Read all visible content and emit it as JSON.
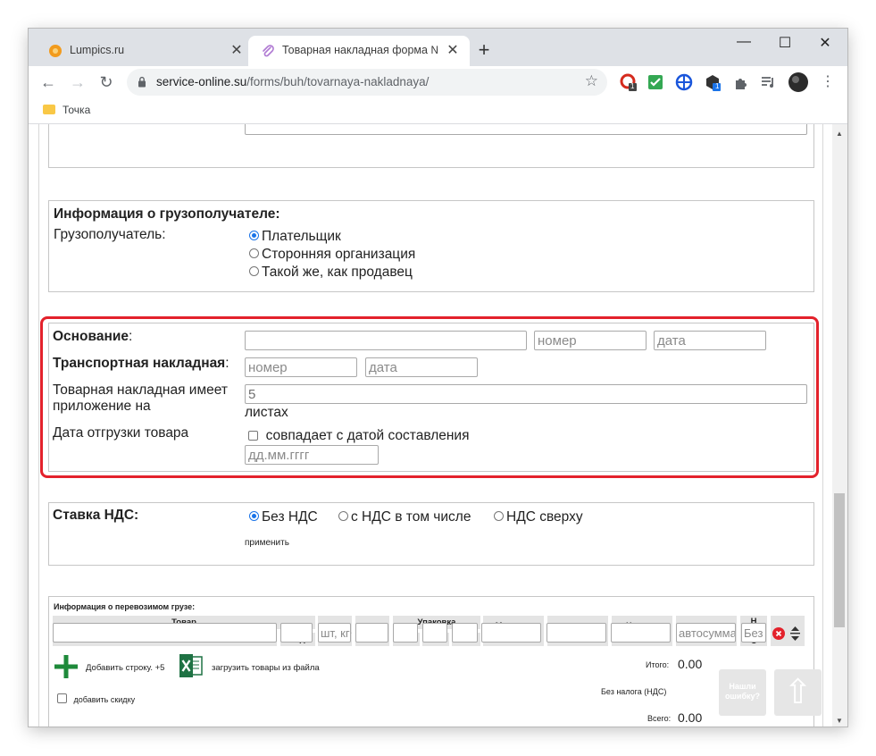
{
  "browser": {
    "tabs": [
      {
        "title": "Lumpics.ru",
        "favicon": "lumpics-orange-circle-icon",
        "active": false
      },
      {
        "title": "Товарная накладная форма №",
        "favicon": "paperclip-icon",
        "active": true
      }
    ],
    "new_tab": "+",
    "window_controls": {
      "minimize": "—",
      "maximize": "☐",
      "close": "✕"
    },
    "url_domain": "service-online.su",
    "url_path": "/forms/buh/tovarnaya-nakladnaya/",
    "bookmarks": [
      "Точка"
    ],
    "extension_badges": [
      "1",
      "1"
    ]
  },
  "form": {
    "consignee_section": {
      "heading": "Информация о грузополучателе:",
      "label": "Грузополучатель:",
      "options": [
        "Плательщик",
        "Сторонняя организация",
        "Такой же, как продавец"
      ],
      "selected": 0
    },
    "basis_section": {
      "basis_label": "Основание",
      "basis_colon": ":",
      "number_placeholder": "номер",
      "date_placeholder": "дата",
      "transport_label": "Транспортная накладная",
      "transport_colon": ":",
      "transport_number_placeholder": "номер",
      "transport_date_placeholder": "дата",
      "attachment_label_line1": "Товарная накладная имеет",
      "attachment_label_line2": "приложение на",
      "attachment_value": "5",
      "sheets_label": "листах",
      "shipment_label": "Дата отгрузки товара",
      "same_date_label": "совпадает с датой составления",
      "date_placeholder_format": "дд.мм.гггг"
    },
    "vat_section": {
      "heading": "Ставка НДС:",
      "options": [
        "Без НДС",
        "с НДС в том числе",
        "НДС сверху"
      ],
      "selected": 0,
      "apply_link": "применить"
    },
    "cargo_section": {
      "heading": "Информация о перевозимом грузе:",
      "headers": {
        "goods": "Товар",
        "name": "наименование",
        "code": "код",
        "unit": "Ед. изм.",
        "okei": "код ОКЕИ",
        "package": "Упаковка",
        "pkg_type": "вид уп.",
        "pkg_qty": "к.в.о.м",
        "pkg_places": "к.мест",
        "mass": "Масса кг единицы",
        "qty": "Кол-во",
        "price": "Цена за единицу",
        "sum": "Сумма",
        "vat": "НДС"
      },
      "row_placeholders": {
        "unit": "шт, кг",
        "sum": "автосумма",
        "vat": "Без"
      },
      "add_row_label": "Добавить строку. +5",
      "load_file_label": "загрузить товары из файла",
      "discount_label": "добавить скидку",
      "total_label": "Итого:",
      "total_value": "0.00",
      "no_tax_label": "Без налога (НДС)",
      "grand_total_label": "Всего:",
      "grand_total_value": "0.00"
    },
    "error_button": "Нашли ошибку?",
    "up_button": "⇧"
  }
}
